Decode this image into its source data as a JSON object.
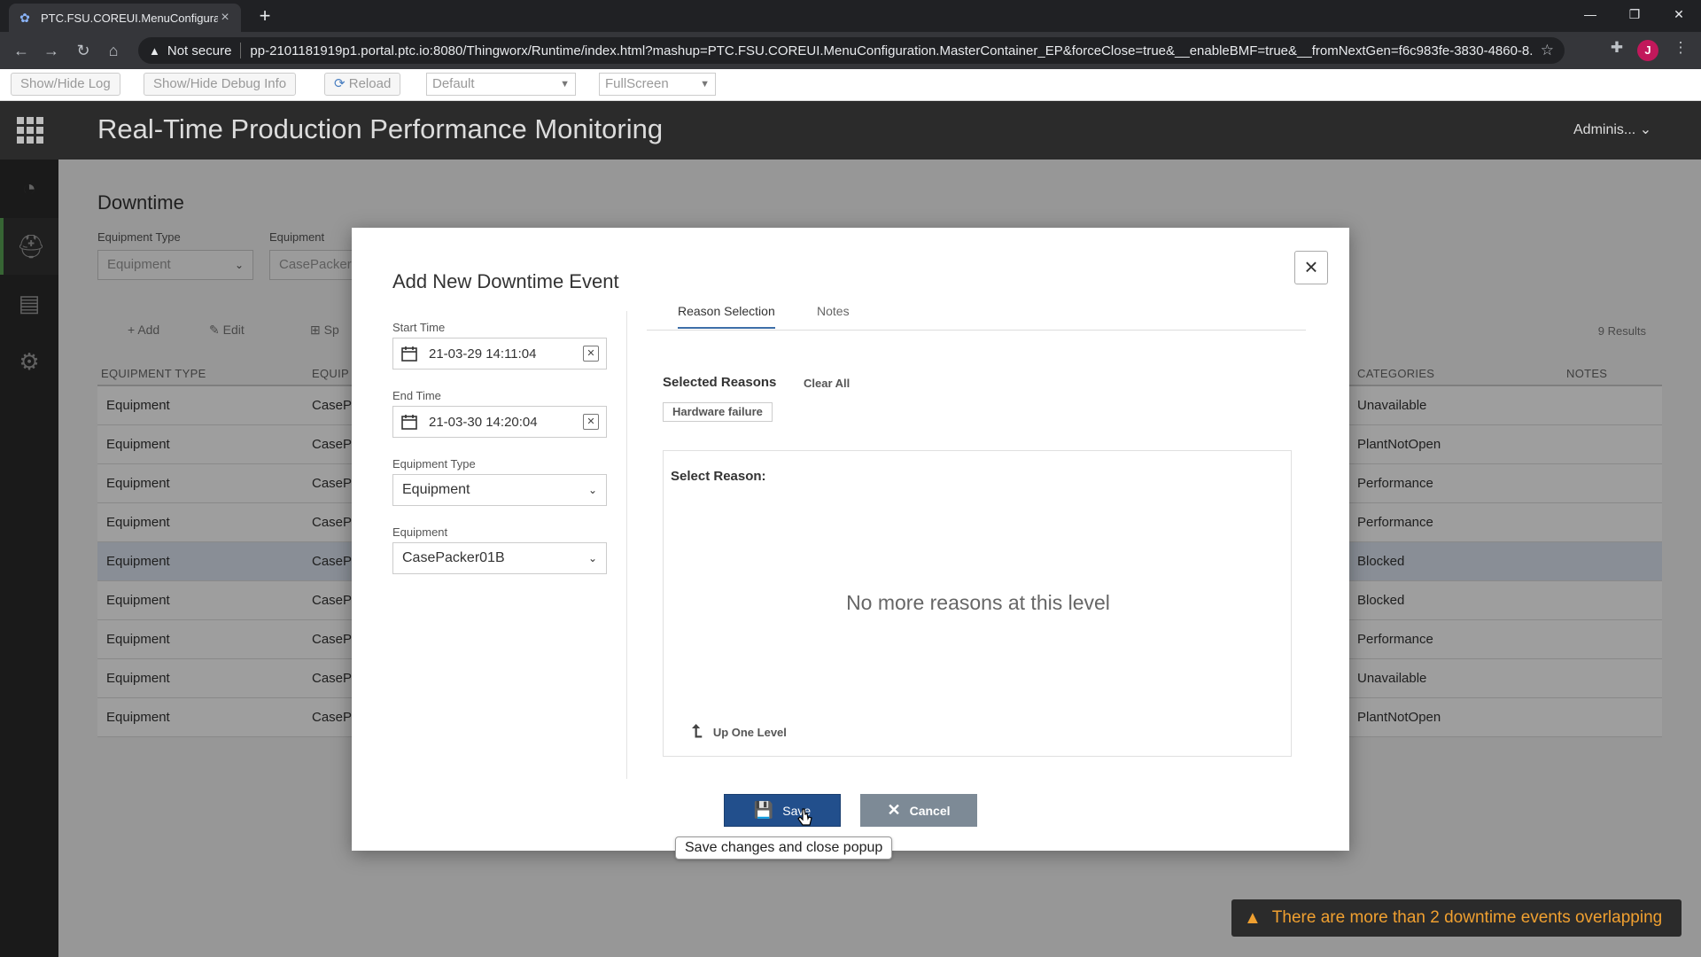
{
  "browser": {
    "tab_title": "PTC.FSU.COREUI.MenuConfiguration",
    "security_label": "Not secure",
    "url": "pp-2101181919p1.portal.ptc.io:8080/Thingworx/Runtime/index.html?mashup=PTC.FSU.COREUI.MenuConfiguration.MasterContainer_EP&forceClose=true&__enableBMF=true&__fromNextGen=f6c983fe-3830-4860-8...",
    "profile_initial": "J"
  },
  "debugbar": {
    "show_hide_log": "Show/Hide Log",
    "show_hide_debug": "Show/Hide Debug Info",
    "reload": "Reload",
    "theme_select": "Default",
    "mode_select": "FullScreen"
  },
  "app": {
    "title": "Real-Time Production Performance Monitoring",
    "user_menu": "Adminis... ⌄"
  },
  "page": {
    "title": "Downtime",
    "filters": {
      "equipment_type_label": "Equipment Type",
      "equipment_type_value": "Equipment",
      "equipment_label": "Equipment",
      "equipment_value": "CasePacker"
    },
    "toolbar": {
      "add": "Add",
      "edit": "Edit",
      "split": "Sp",
      "results": "9 Results"
    },
    "table": {
      "columns": [
        "EQUIPMENT TYPE",
        "EQUIP",
        "CATEGORIES",
        "NOTES"
      ],
      "rows": [
        [
          "Equipment",
          "CaseP",
          "Unavailable"
        ],
        [
          "Equipment",
          "CaseP",
          "PlantNotOpen"
        ],
        [
          "Equipment",
          "CaseP",
          "Performance"
        ],
        [
          "Equipment",
          "CaseP",
          "Performance"
        ],
        [
          "Equipment",
          "CaseP",
          "Blocked"
        ],
        [
          "Equipment",
          "CaseP",
          "Blocked"
        ],
        [
          "Equipment",
          "CaseP",
          "Performance"
        ],
        [
          "Equipment",
          "CaseP",
          "Unavailable"
        ],
        [
          "Equipment",
          "CaseP",
          "PlantNotOpen"
        ]
      ]
    }
  },
  "modal": {
    "title": "Add New Downtime Event",
    "start_time_label": "Start Time",
    "start_time_value": "21-03-29 14:11:04",
    "end_time_label": "End Time",
    "end_time_value": "21-03-30 14:20:04",
    "equipment_type_label": "Equipment Type",
    "equipment_type_value": "Equipment",
    "equipment_label": "Equipment",
    "equipment_value": "CasePacker01B",
    "tabs": [
      "Reason Selection",
      "Notes"
    ],
    "selected_reasons_label": "Selected Reasons",
    "clear_all": "Clear All",
    "selected_reason_chip": "Hardware failure",
    "select_reason_label": "Select Reason:",
    "empty_message": "No more reasons at this level",
    "up_one_level": "Up One Level",
    "save": "Save",
    "cancel": "Cancel",
    "save_tooltip": "Save changes and close popup"
  },
  "toast": {
    "message": "There are more than 2 downtime events overlapping",
    "color": "#f0a030"
  }
}
